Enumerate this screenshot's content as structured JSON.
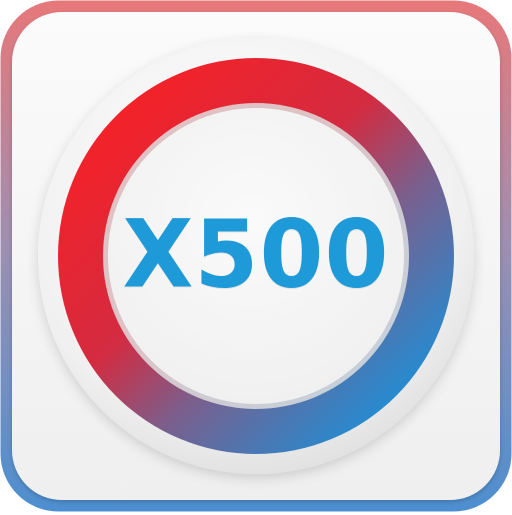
{
  "app_icon": {
    "label": "X500",
    "icon_name": "x500-app-icon",
    "colors": {
      "ring_red": "#f1222a",
      "ring_blue": "#1e8fd6",
      "frame_red": "#e7787a",
      "frame_blue": "#4c8fd0",
      "text_blue": "#1f9ad8",
      "inner_disc": "#f3f3f3",
      "tile_background": "#f5f5f5"
    }
  }
}
